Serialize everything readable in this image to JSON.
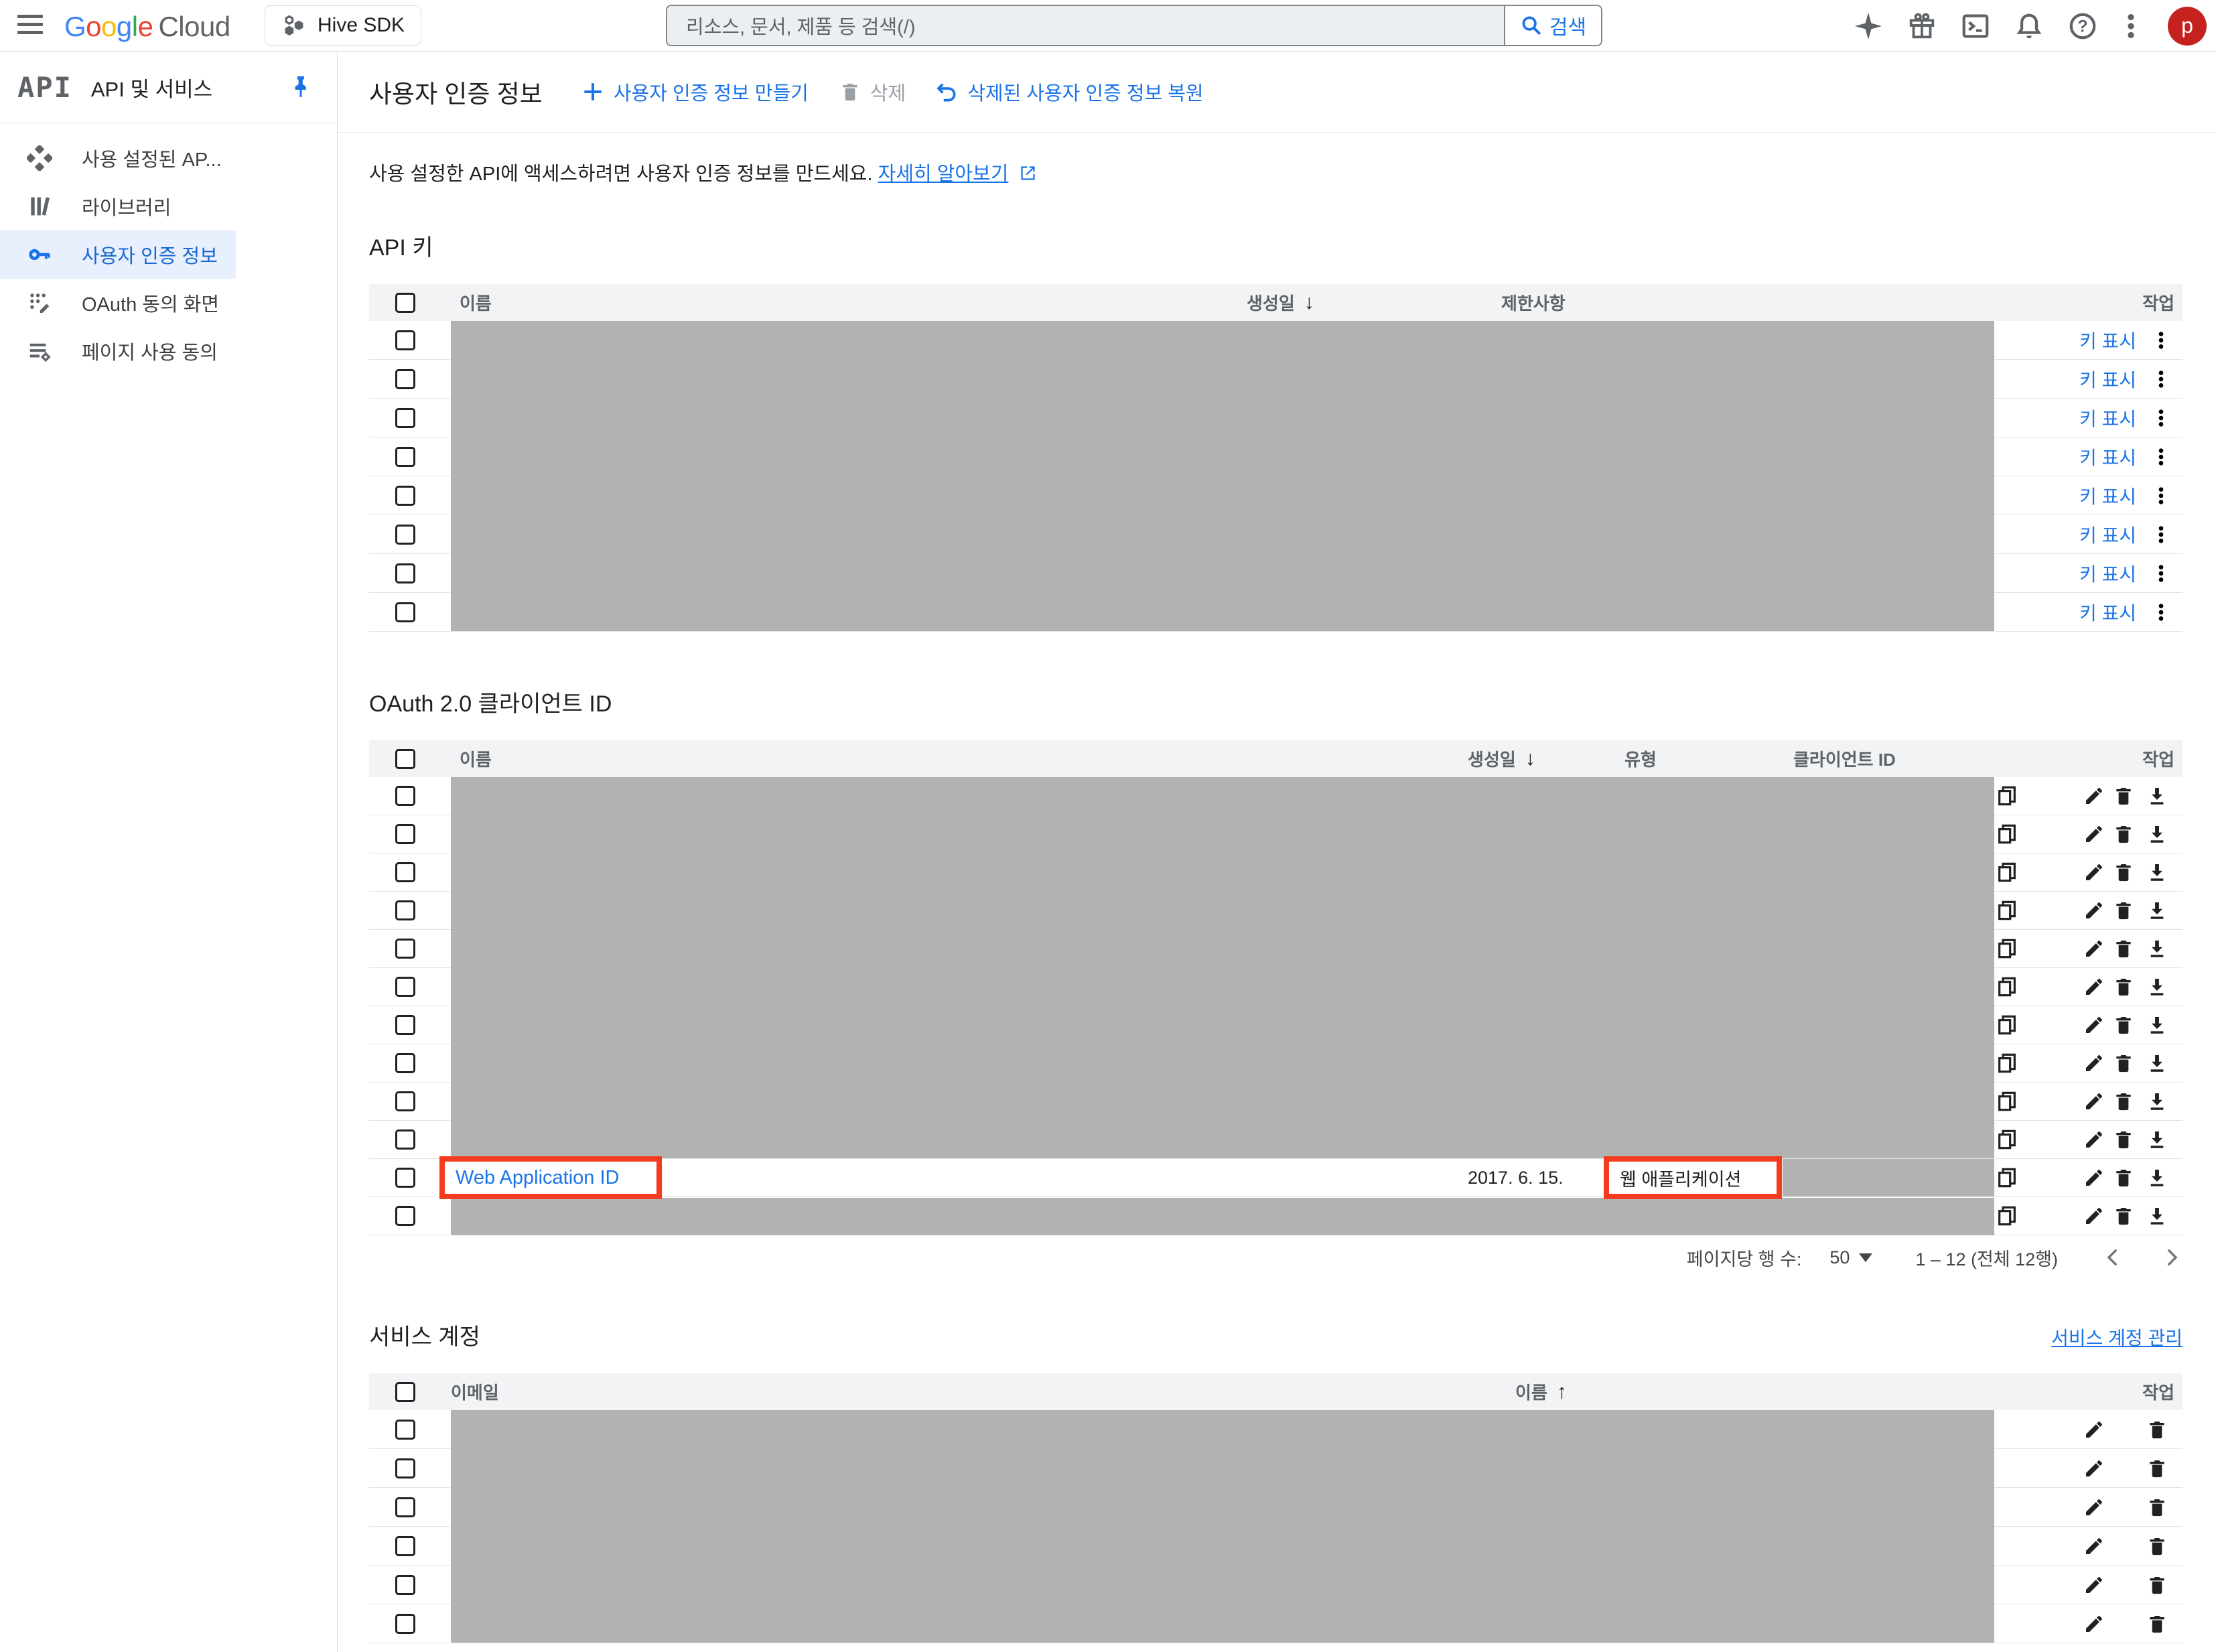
{
  "topbar": {
    "logo_letters": [
      {
        "ch": "G"
      },
      {
        "ch": "o"
      },
      {
        "ch": "o"
      },
      {
        "ch": "g"
      },
      {
        "ch": "l"
      },
      {
        "ch": "e"
      }
    ],
    "logo_cloud": "Cloud",
    "project_name": "Hive SDK",
    "search_placeholder": "리소스, 문서, 제품 등 검색(/)",
    "search_button": "검색",
    "avatar_initial": "p",
    "icons": [
      "menu",
      "gemini-sparkle",
      "gift",
      "cloud-shell",
      "notifications",
      "help",
      "more-vert",
      "avatar"
    ]
  },
  "sidebar": {
    "product_logo": "API",
    "title": "API 및 서비스",
    "items": [
      {
        "label": "사용 설정된 AP...",
        "icon": "enabled-apis",
        "selected": false
      },
      {
        "label": "라이브러리",
        "icon": "library",
        "selected": false
      },
      {
        "label": "사용자 인증 정보",
        "icon": "key",
        "selected": true
      },
      {
        "label": "OAuth 동의 화면",
        "icon": "oauth-consent",
        "selected": false
      },
      {
        "label": "페이지 사용 동의",
        "icon": "page-consent",
        "selected": false
      }
    ]
  },
  "header": {
    "title": "사용자 인증 정보",
    "create_button": "사용자 인증 정보 만들기",
    "delete_button": "삭제",
    "restore_button": "삭제된 사용자 인증 정보 복원"
  },
  "intro": {
    "text": "사용 설정한 API에 액세스하려면 사용자 인증 정보를 만드세요.",
    "link": "자세히 알아보기"
  },
  "api_keys": {
    "title": "API 키",
    "columns": {
      "name": "이름",
      "created": "생성일",
      "restrictions": "제한사항",
      "actions": "작업"
    },
    "sort": {
      "column": "생성일",
      "direction": "desc"
    },
    "show_key_label": "키 표시",
    "row_count": 8,
    "rows_redacted": true
  },
  "oauth": {
    "title": "OAuth 2.0 클라이언트 ID",
    "columns": {
      "name": "이름",
      "created": "생성일",
      "type": "유형",
      "client_id": "클라이언트 ID",
      "actions": "작업"
    },
    "sort": {
      "column": "생성일",
      "direction": "desc"
    },
    "row_count": 12,
    "highlight_row": {
      "position": 11,
      "name": "Web Application ID",
      "created": "2017. 6. 15.",
      "type": "웹 애플리케이션",
      "client_id_redacted": true,
      "annotated": true
    }
  },
  "pagination": {
    "rows_per_page_label": "페이지당 행 수:",
    "rows_per_page": "50",
    "range": "1 – 12 (전체 12행)"
  },
  "service_accounts": {
    "title": "서비스 계정",
    "manage_link": "서비스 계정 관리",
    "columns": {
      "email": "이메일",
      "name": "이름",
      "actions": "작업"
    },
    "sort": {
      "column": "이름",
      "direction": "asc"
    },
    "row_count": 6,
    "rows_redacted": true
  },
  "colors": {
    "accent_blue": "#1a73e8",
    "selected_nav_blue": "#1967d2",
    "annotation_red": "#f43b1e",
    "redaction_grey": "#b2b2b2",
    "avatar_red": "#c5221f"
  }
}
